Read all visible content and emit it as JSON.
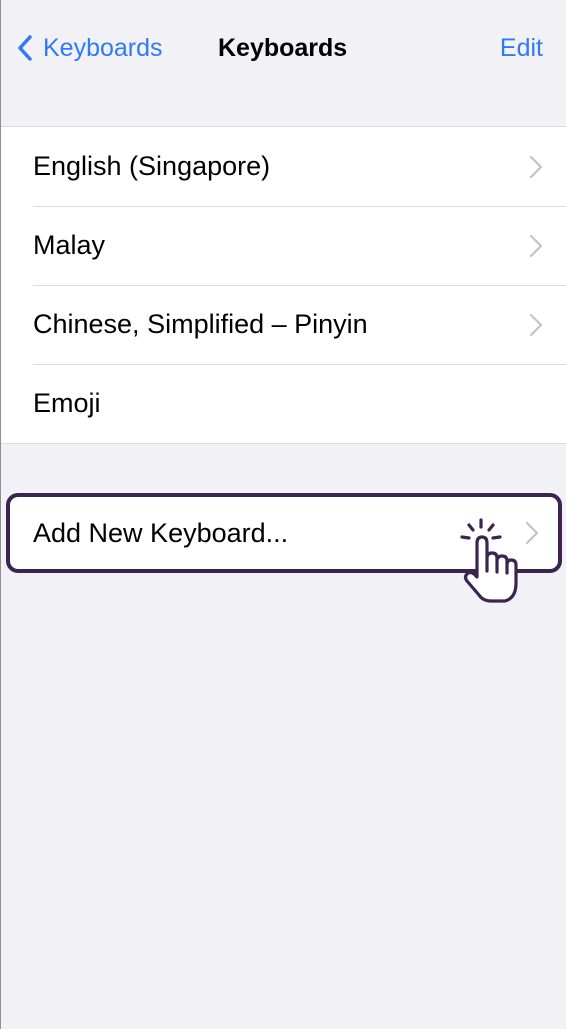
{
  "nav": {
    "back_label": "Keyboards",
    "title": "Keyboards",
    "edit_label": "Edit"
  },
  "keyboards": [
    {
      "label": "English (Singapore)",
      "chevron": true
    },
    {
      "label": "Malay",
      "chevron": true
    },
    {
      "label": "Chinese, Simplified – Pinyin",
      "chevron": true
    },
    {
      "label": "Emoji",
      "chevron": false
    }
  ],
  "add_keyboard": {
    "label": "Add New Keyboard..."
  },
  "colors": {
    "accent": "#2f7bf5",
    "background": "#f2f1f6",
    "highlight_border": "#3b2550"
  },
  "icons": {
    "back": "chevron-left-icon",
    "row": "chevron-right-icon",
    "pointer": "tap-hand-icon"
  }
}
